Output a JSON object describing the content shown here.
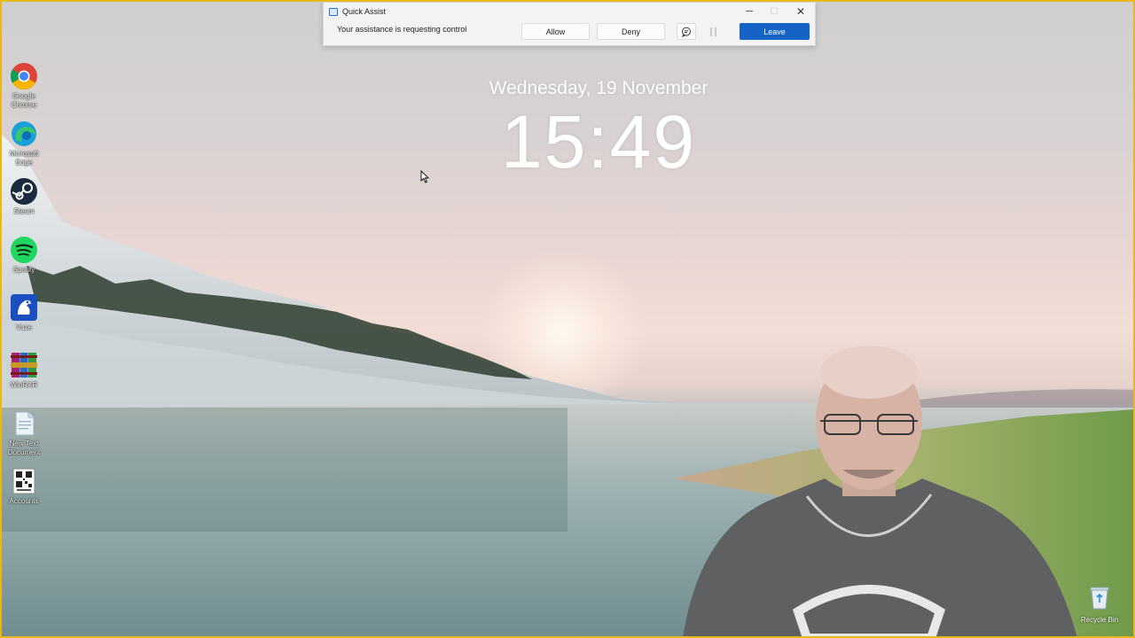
{
  "clock": {
    "date": "Wednesday, 19 November",
    "time": "15:49"
  },
  "quick_assist": {
    "title": "Quick Assist",
    "message": "Your assistance is requesting control",
    "allow_label": "Allow",
    "deny_label": "Deny",
    "leave_label": "Leave",
    "minimize_glyph": "─",
    "maximize_glyph": "☐",
    "close_glyph": "✕"
  },
  "desktop_icons": [
    {
      "label": "Google Chrome",
      "icon": "chrome-icon"
    },
    {
      "label": "Microsoft Edge",
      "icon": "edge-icon"
    },
    {
      "label": "Steam",
      "icon": "steam-icon"
    },
    {
      "label": "Spotify",
      "icon": "spotify-icon"
    },
    {
      "label": "Vuze",
      "icon": "vuze-icon"
    },
    {
      "label": "WinRAR",
      "icon": "winrar-icon"
    },
    {
      "label": "New Text Document",
      "icon": "text-document-icon"
    },
    {
      "label": "Accounts",
      "icon": "qr-document-icon"
    }
  ],
  "recycle_bin": {
    "label": "Recycle Bin"
  },
  "colors": {
    "accent_button": "#1463c5",
    "frame_border": "#e8b71a"
  }
}
